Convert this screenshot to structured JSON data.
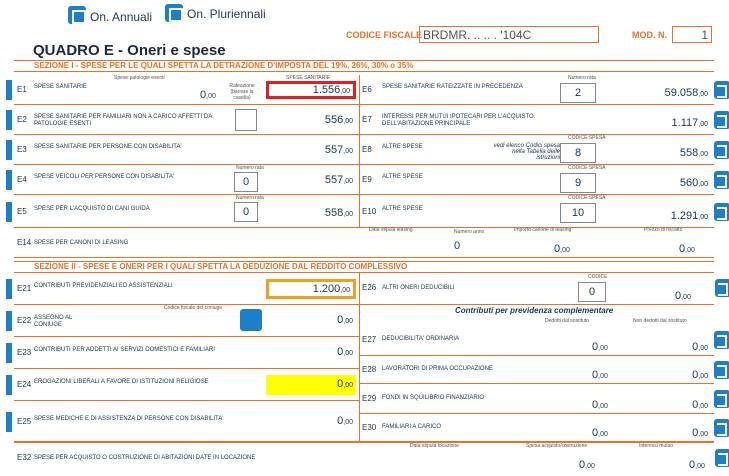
{
  "header": {
    "annual": "On. Annuali",
    "multi": "On. Pluriennali",
    "cf_label": "CODICE FISCALE",
    "cf_value": "BRDMR. .. .. . '104C",
    "mod_label": "MOD. N.",
    "mod_value": "1"
  },
  "title": "QUADRO E - Oneri e spese",
  "sec1": "SEZIONE I  -  SPESE PER LE QUALI SPETTA LA DETRAZIONE D'IMPOSTA DEL 19%, 26%, 30% o 35%",
  "sec2": "SEZIONE II  -  SPESE E ONERI PER I QUALI SPETTA LA DEDUZIONE DAL REDDITO COMPLESSIVO",
  "left1": [
    {
      "code": "E1",
      "label": "SPESE SANITARIE",
      "v1": "0",
      "c1": ",00",
      "v2": "1.556",
      "c2": ",00"
    },
    {
      "code": "E2",
      "label": "SPESE SANITARIE PER FAMILIARI NON A CARICO AFFETTI DA PATOLOGIE ESENTI",
      "v2": "556",
      "c2": ",00"
    },
    {
      "code": "E3",
      "label": "SPESE SANITARIE PER PERSONE CON DISABILITA'",
      "v2": "557",
      "c2": ",00"
    },
    {
      "code": "E4",
      "label": "SPESE VEICOLI PER PERSONE CON DISABILITA'",
      "n": "0",
      "v2": "557",
      "c2": ",00"
    },
    {
      "code": "E5",
      "label": "SPESE PER L'ACQUISTO DI CANI GUIDA",
      "n": "0",
      "v2": "558",
      "c2": ",00"
    }
  ],
  "right1": [
    {
      "code": "E6",
      "label": "SPESE SANITARIE RATEIZZATE IN PRECEDENZA",
      "n": "2",
      "v": "59.058",
      "c": ",00"
    },
    {
      "code": "E7",
      "label": "INTERESSI PER MUTUI IPOTECARI PER L'ACQUISTO DELL'ABITAZIONE PRINCIPALE",
      "v": "1.117",
      "c": ",00"
    },
    {
      "code": "E8",
      "label": "ALTRE SPESE",
      "n": "8",
      "v": "558",
      "c": ",00"
    },
    {
      "code": "E9",
      "label": "ALTRE SPESE",
      "n": "9",
      "v": "560",
      "c": ",00"
    },
    {
      "code": "E10",
      "label": "ALTRE SPESE",
      "n": "10",
      "v": "1.291",
      "c": ",00"
    }
  ],
  "e1_sub": {
    "a": "Spese patologie esenti",
    "b": "SPESE SANITARIE",
    "c": "Rateazione (barrare la casella)"
  },
  "e6_sub": "Numero rata",
  "e8_note": "vedi elenco Codici spesa nella Tabella delle istruzioni",
  "cod_spesa": "CODICE SPESA",
  "num_rata": "Numero rata",
  "e14": {
    "code": "E14",
    "label": "SPESE PER CANONI DI LEASING",
    "h1": "Data stipula leasing",
    "h2": "Numero anno",
    "h3": "Importo canone di leasing",
    "h4": "Prezzo di riscatto",
    "n": "0",
    "v3": "0",
    "c3": ",00",
    "v4": "0",
    "c4": ",00"
  },
  "left2": [
    {
      "code": "E21",
      "label": "CONTRIBUTI PREVIDENZIALI ED ASSISTENZIALI",
      "v": "1.200",
      "c": ",00"
    },
    {
      "code": "E22",
      "label": "ASSEGNO AL CONIUGE",
      "sub": "Codice fiscale del coniuge",
      "v": "0",
      "c": ",00"
    },
    {
      "code": "E23",
      "label": "CONTRIBUTI PER ADDETTI AI SERVIZI DOMESTICI E FAMILIARI",
      "v": "0",
      "c": ",00"
    },
    {
      "code": "E24",
      "label": "EROGAZIONI LIBERALI A FAVORE DI ISTITUZIONI RELIGIOSE",
      "v": "0",
      "c": ",00"
    },
    {
      "code": "E25",
      "label": "SPESE MEDICHE E DI ASSISTENZA DI PERSONE CON DISABILITA'",
      "v": "0",
      "c": ",00"
    }
  ],
  "e26": {
    "code": "E26",
    "label": "ALTRI ONERI DEDUCIBILI",
    "h": "CODICE",
    "n": "0",
    "v": "0",
    "c": ",00"
  },
  "contrib": {
    "title": "Contributi per previdenza complementare",
    "h1": "Dedotti dal sostituto",
    "h2": "Non dedotti dal sostituto"
  },
  "right2": [
    {
      "code": "E27",
      "label": "DEDUCIBILITA' ORDINARIA",
      "v1": "0",
      "v2": "0"
    },
    {
      "code": "E28",
      "label": "LAVORATORI DI PRIMA OCCUPAZIONE",
      "v1": "0",
      "v2": "0"
    },
    {
      "code": "E29",
      "label": "FONDI IN SQUILIBRIO FINANZIARIO",
      "v1": "0",
      "v2": "0"
    },
    {
      "code": "E30",
      "label": "FAMILIARI A CARICO",
      "v1": "0",
      "v2": "0"
    }
  ],
  "cents": ",00",
  "e32": {
    "code": "E32",
    "label": "SPESE PER ACQUISTO O COSTRUZIONE DI ABITAZIONI DATE IN LOCAZIONE",
    "h1": "Data stipula locazione",
    "h2": "Spesa acquisto/costruzione",
    "h3": "Interessi mutuo",
    "v2": "0",
    "v3": "0",
    "c": ",00"
  }
}
